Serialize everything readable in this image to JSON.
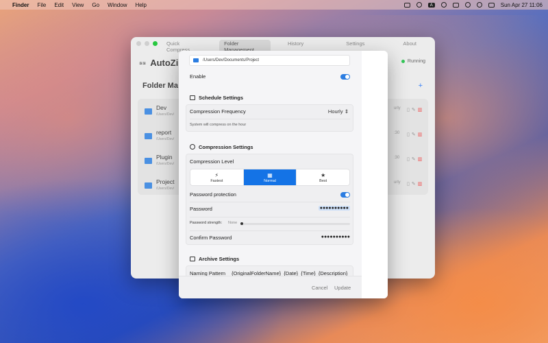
{
  "menubar": {
    "app": "Finder",
    "items": [
      "File",
      "Edit",
      "View",
      "Go",
      "Window",
      "Help"
    ],
    "clock": "Sun Apr 27  11:06",
    "status_a": "A"
  },
  "bgwin": {
    "tabs": [
      "Quick Compress",
      "Folder Management",
      "History",
      "Settings",
      "About"
    ],
    "brand": "AutoZi",
    "brand_icon": "≋≋",
    "status": "Running",
    "heading": "Folder Ma",
    "plus": "+",
    "rows": [
      {
        "name": "Dev",
        "path": "/Users/Dev/",
        "meta1": "urly",
        "meta2": "mal"
      },
      {
        "name": "report",
        "path": "/Users/Dev/",
        "meta1": ":30",
        "meta2": "mal"
      },
      {
        "name": "Plugin",
        "path": "/Users/Dev/",
        "meta1": ":30",
        "meta2": "mal"
      },
      {
        "name": "Project",
        "path": "/Users/Dev/",
        "meta1": "urly",
        "meta2": "mal"
      }
    ]
  },
  "sheet": {
    "path": "/Users/Dev/Documents/Project",
    "enable_label": "Enable",
    "schedule": {
      "title": "Schedule Settings",
      "frequency_label": "Compression Frequency",
      "frequency_value": "Hourly",
      "note": "System will compress on the hour"
    },
    "compression": {
      "title": "Compression Settings",
      "level_label": "Compression Level",
      "levels": [
        {
          "glyph": "⚡",
          "label": "Fastest"
        },
        {
          "glyph": "▦",
          "label": "Normal"
        },
        {
          "glyph": "★",
          "label": "Best"
        }
      ],
      "password_protection_label": "Password protection",
      "password_label": "Password",
      "password_dots": "●●●●●●●●●●",
      "strength_label": "Password strength:",
      "strength_value": "None",
      "confirm_label": "Confirm Password",
      "confirm_dots": "●●●●●●●●●●"
    },
    "archive": {
      "title": "Archive Settings",
      "naming_label": "Naming Pattern",
      "naming_value": "{OriginalFolderName}_{Date}_{Time}_{Description}"
    },
    "footer": {
      "cancel": "Cancel",
      "update": "Update"
    }
  }
}
